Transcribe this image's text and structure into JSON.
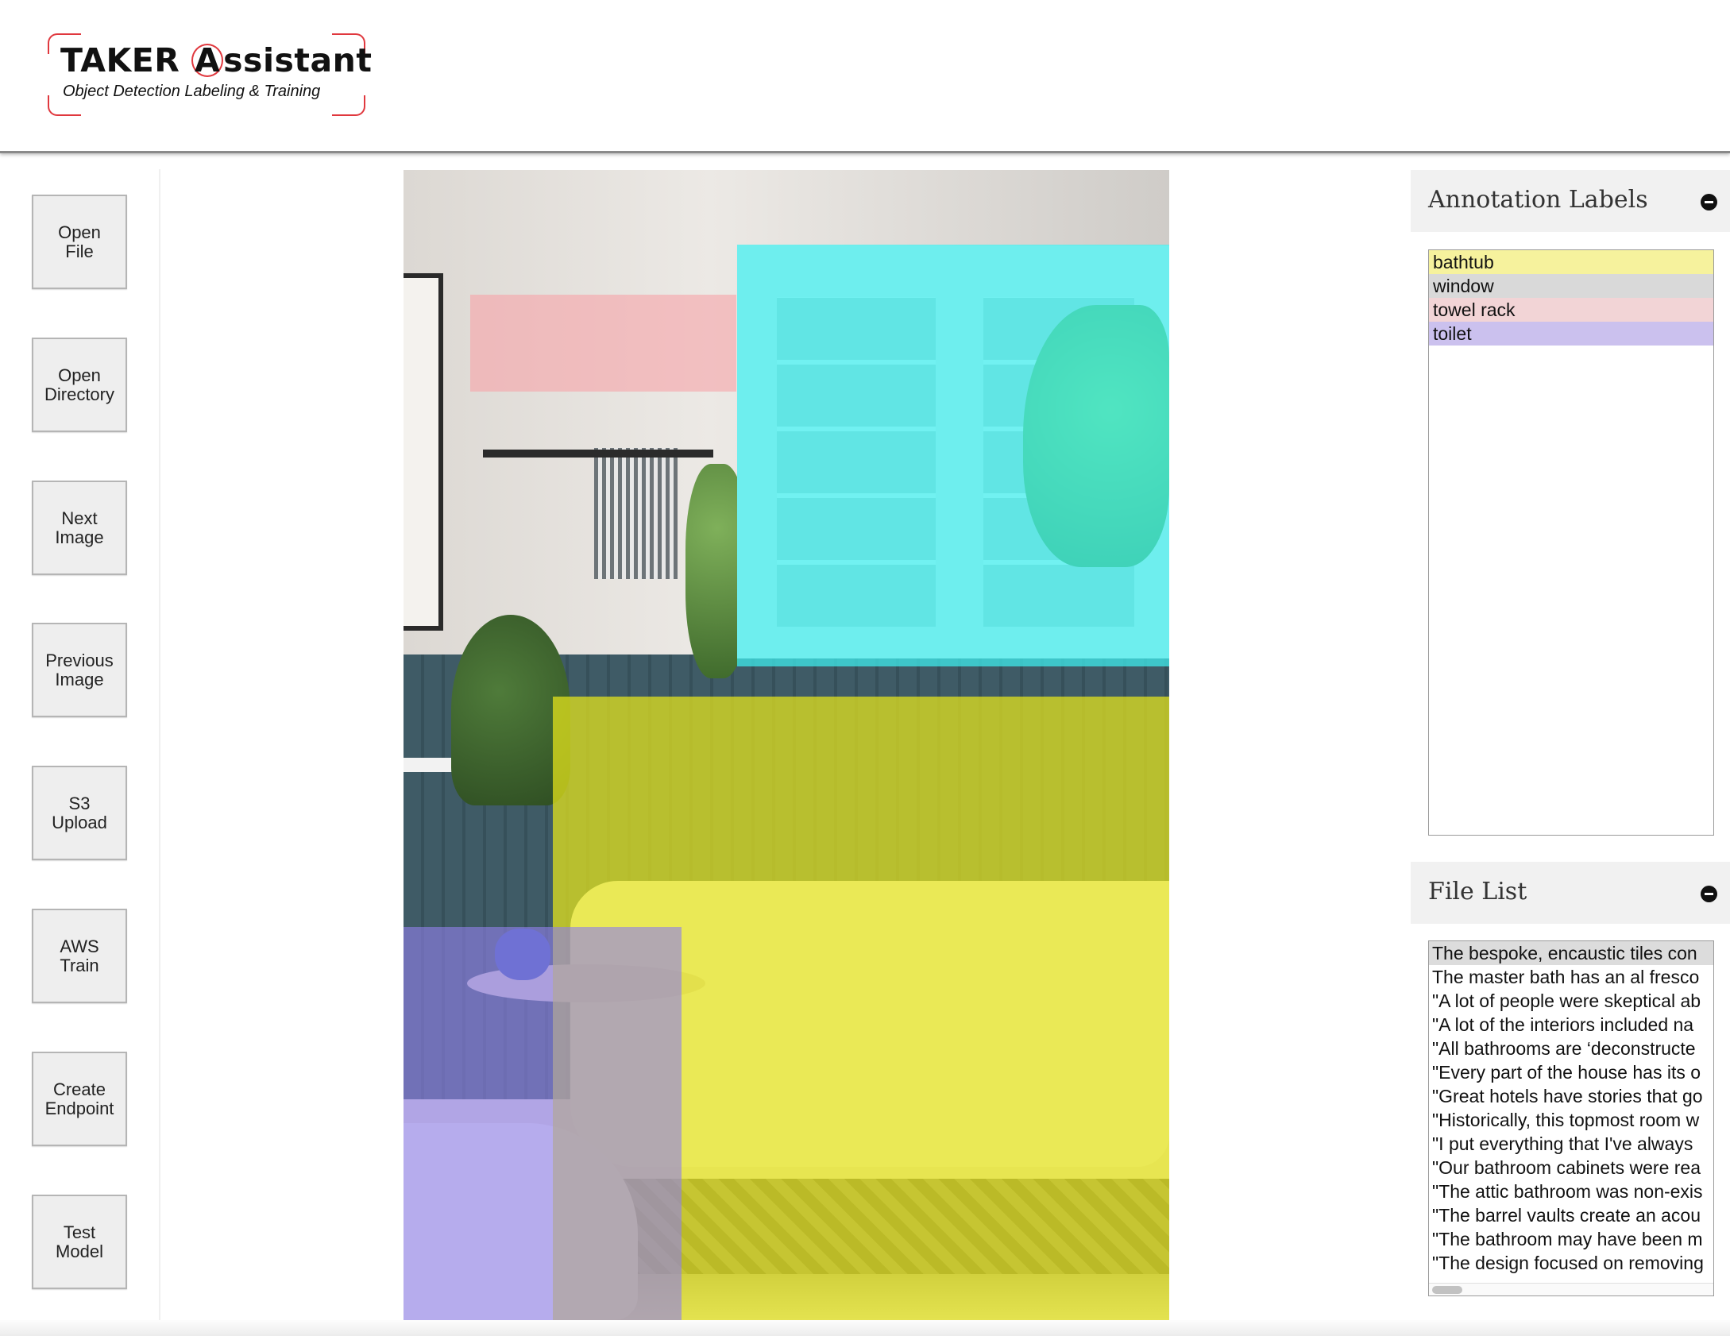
{
  "header": {
    "logo_title_pre": "TAKER ",
    "logo_title_a": "A",
    "logo_title_post": "ssistant",
    "logo_subtitle": "Object Detection Labeling & Training"
  },
  "sidebar": {
    "buttons": [
      {
        "label": "Open\nFile"
      },
      {
        "label": "Open\nDirectory"
      },
      {
        "label": "Next\nImage"
      },
      {
        "label": "Previous\nImage"
      },
      {
        "label": "S3\nUpload"
      },
      {
        "label": "AWS\nTrain"
      },
      {
        "label": "Create\nEndpoint"
      },
      {
        "label": "Test\nModel"
      }
    ]
  },
  "labels_panel": {
    "title": "Annotation Labels",
    "items": [
      {
        "label": "bathtub",
        "color": "#f6f29d"
      },
      {
        "label": "window",
        "color": "#d9d9d9"
      },
      {
        "label": "towel rack",
        "color": "#f2d4d6"
      },
      {
        "label": "toilet",
        "color": "#cbc1ee"
      }
    ]
  },
  "annotation_colors": {
    "bathtub": "#e8e61a",
    "window": "#3ff0f0",
    "towel_rack": "#f6a3a8",
    "toilet": "#8f80e8"
  },
  "file_panel": {
    "title": "File List",
    "files": [
      "The bespoke, encaustic tiles con",
      "The master bath has an al fresco",
      "\"A lot of people were skeptical ab",
      "\"A lot of the interiors included na",
      "\"All bathrooms are ‘deconstructe",
      "\"Every part of the house has its o",
      "\"Great hotels have stories that go",
      "\"Historically, this topmost room w",
      "\"I put everything that I've always",
      "\"Our bathroom cabinets were rea",
      "\"The attic bathroom was non-exis",
      "\"The barrel vaults create an acou",
      "\"The bathroom may have been m",
      "\"The design focused on removing"
    ]
  }
}
